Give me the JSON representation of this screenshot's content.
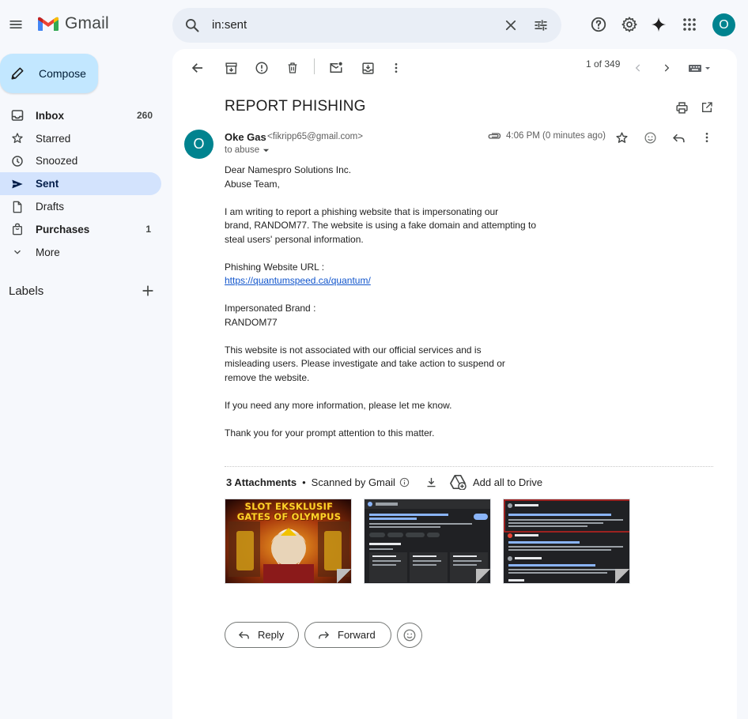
{
  "app": {
    "name": "Gmail"
  },
  "search": {
    "value": "in:sent"
  },
  "account": {
    "initial": "O"
  },
  "compose": {
    "label": "Compose"
  },
  "sidebar": {
    "items": [
      {
        "label": "Inbox",
        "count": "260",
        "icon": "inbox-icon"
      },
      {
        "label": "Starred",
        "count": "",
        "icon": "star-icon"
      },
      {
        "label": "Snoozed",
        "count": "",
        "icon": "clock-icon"
      },
      {
        "label": "Sent",
        "count": "",
        "icon": "send-icon"
      },
      {
        "label": "Drafts",
        "count": "",
        "icon": "draft-icon"
      },
      {
        "label": "Purchases",
        "count": "1",
        "icon": "shopping-bag-icon"
      },
      {
        "label": "More",
        "count": "",
        "icon": "chevron-down-icon"
      }
    ],
    "labels_title": "Labels"
  },
  "toolbar": {
    "pager": "1 of 349"
  },
  "email": {
    "subject": "REPORT PHISHING",
    "sender_initial": "O",
    "sender_name": "Oke Gas",
    "sender_email": "<fikripp65@gmail.com>",
    "to": "to abuse",
    "time": "4:06 PM (0 minutes ago)",
    "body": {
      "greeting_1": "Dear Namespro Solutions Inc.",
      "greeting_2": "Abuse Team,",
      "para1_l1": "I am writing to report a phishing website that is impersonating our",
      "para1_l2": "brand, RANDOM77. The website is using a fake domain and attempting to",
      "para1_l3": "steal users' personal information.",
      "url_label": "Phishing Website URL :",
      "url": "https://quantumspeed.ca/quantum/",
      "brand_label": "Impersonated Brand :",
      "brand": "RANDOM77",
      "para2_l1": "This website is not associated with our official services and is",
      "para2_l2": "misleading users. Please investigate and take action to suspend or",
      "para2_l3": "remove the website.",
      "para3": "If you need any more information, please let me know.",
      "para4": "Thank you for your prompt attention to this matter."
    }
  },
  "attachments": {
    "count_label": "3 Attachments",
    "dot": "•",
    "scanned": "Scanned by Gmail",
    "add_drive": "Add all to Drive",
    "thumb1_line1": "SLOT EKSKLUSIF",
    "thumb1_line2": "GATES OF OLYMPUS"
  },
  "actions": {
    "reply": "Reply",
    "forward": "Forward"
  }
}
